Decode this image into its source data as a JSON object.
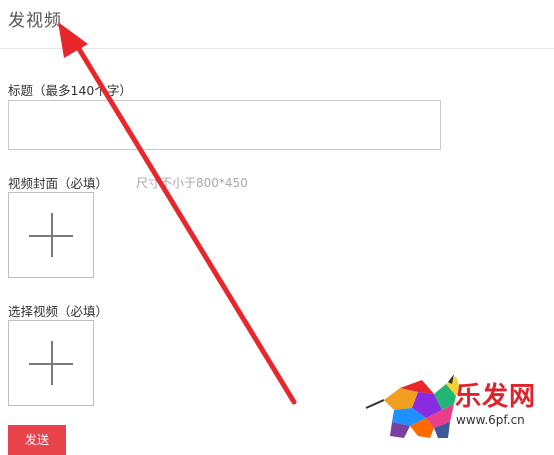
{
  "page": {
    "title": "发视频"
  },
  "form": {
    "title_label": "标题（最多140个字）",
    "title_value": "",
    "cover_label": "视频封面（必填）",
    "cover_hint": "尺寸不小于800*450",
    "video_label": "选择视频（必填）",
    "send_label": "发送"
  },
  "icons": {
    "upload_cover": "plus-icon",
    "upload_video": "plus-icon",
    "annotation": "red-arrow-icon",
    "watermark": "bull-logo-icon"
  },
  "watermark": {
    "brand": "乐发网",
    "url": "www.6pf.cn"
  },
  "colors": {
    "accent": "#e8434a",
    "arrow": "#e8262b",
    "border": "#c9c9c9",
    "hint": "#a8a8a8"
  }
}
